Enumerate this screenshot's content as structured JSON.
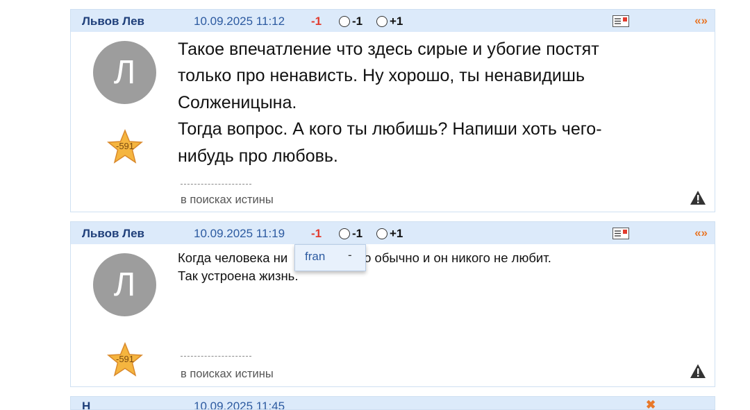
{
  "posts": [
    {
      "author": "Львов Лев",
      "date": "10.09.2025 11:12",
      "rating": "-1",
      "vote_minus": "-1",
      "vote_plus": "+1",
      "quote": "«»",
      "avatar_letter": "Л",
      "karma": "-591",
      "lines": [
        "Такое впечатление что здесь сирые и убогие постят",
        "только про ненависть. Ну хорошо, ты ненавидишь",
        "Солженицына.",
        "Тогда вопрос. А кого ты любишь? Напиши хоть чего-",
        "нибудь про любовь."
      ],
      "signature": "в поисках истины"
    },
    {
      "author": "Львов Лев",
      "date": "10.09.2025 11:19",
      "rating": "-1",
      "vote_minus": "-1",
      "vote_plus": "+1",
      "quote": "«»",
      "avatar_letter": "Л",
      "karma": "-591",
      "lines": [
        "Когда человека ни",
        "бит, то обычно и он никого не любит.",
        "Так устроена жизнь."
      ],
      "signature": "в поисках истины"
    }
  ],
  "popup": {
    "name": "fran",
    "dash": "-"
  },
  "next_post": {
    "author": "Н",
    "date": "10.09.2025 11:45",
    "icon": "✖"
  },
  "colors": {
    "header_bg": "#dceafa",
    "author": "#1f3f7a",
    "date": "#2c5aa0",
    "rating": "#e23b2e",
    "accent": "#e8782a"
  },
  "icons": {
    "message": "message-icon",
    "warning": "warning-icon",
    "star": "star-icon"
  }
}
